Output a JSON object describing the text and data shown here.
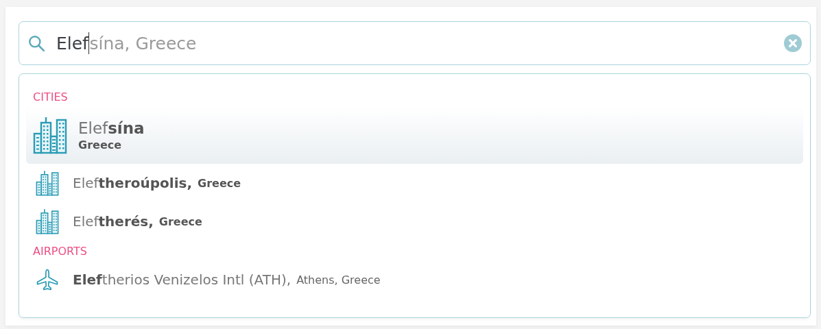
{
  "search": {
    "value": "Elef",
    "completion": "sína, Greece"
  },
  "groups": [
    {
      "label": "CITIES",
      "items": [
        {
          "kind": "city",
          "name": "Elef**sína**",
          "detail": "Greece",
          "selected": true
        },
        {
          "kind": "city",
          "name": "Elef**theroúpolis,**",
          "detail": "Greece",
          "selected": false
        },
        {
          "kind": "city",
          "name": "Elef**therés,**",
          "detail": "Greece",
          "selected": false
        }
      ]
    },
    {
      "label": "AIRPORTS",
      "items": [
        {
          "kind": "airport",
          "name": "**Elef**therios Venizelos Intl (ATH),",
          "detail": "Athens, Greece",
          "selected": false
        }
      ]
    }
  ]
}
